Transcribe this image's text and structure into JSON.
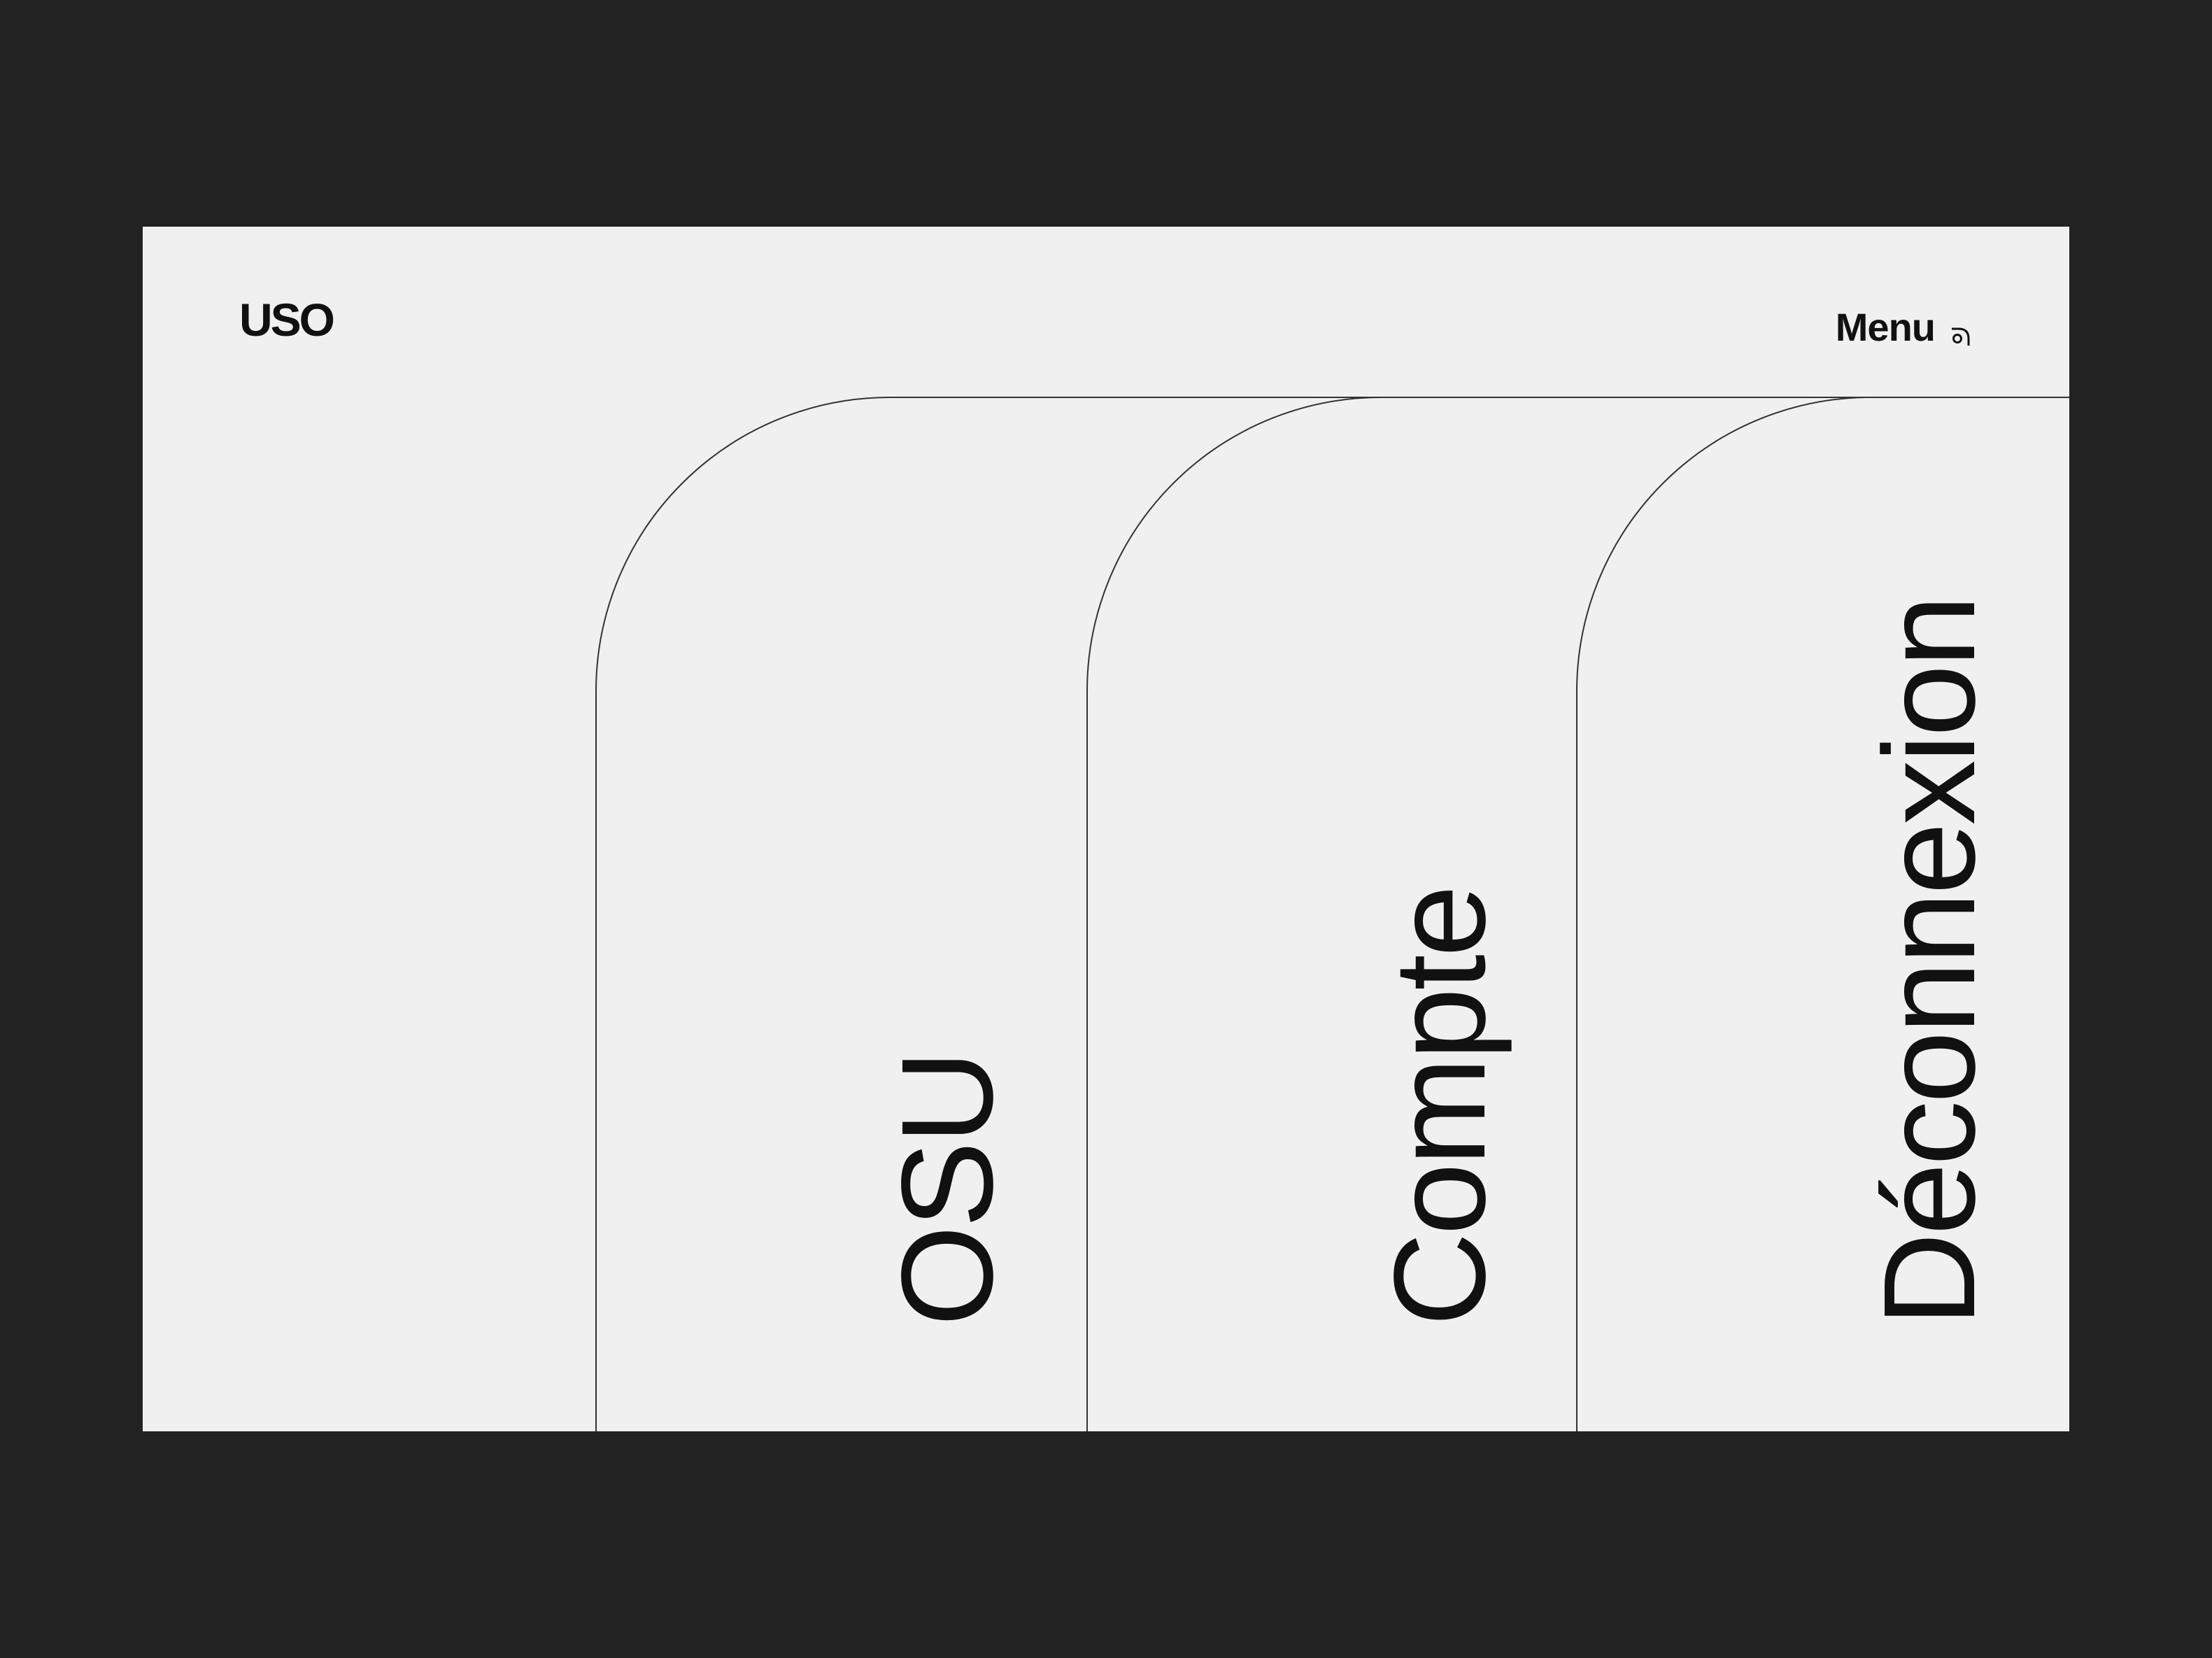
{
  "header": {
    "logo": "USO",
    "menu_label": "Menu",
    "menu_icon": "menu-corner-icon"
  },
  "tabs": [
    {
      "label": "OSU"
    },
    {
      "label": "Compte"
    },
    {
      "label": "Déconnexion"
    }
  ],
  "colors": {
    "background_outer": "#222222",
    "screen_background": "#f0f0f0",
    "text": "#111111",
    "line": "#333333"
  }
}
